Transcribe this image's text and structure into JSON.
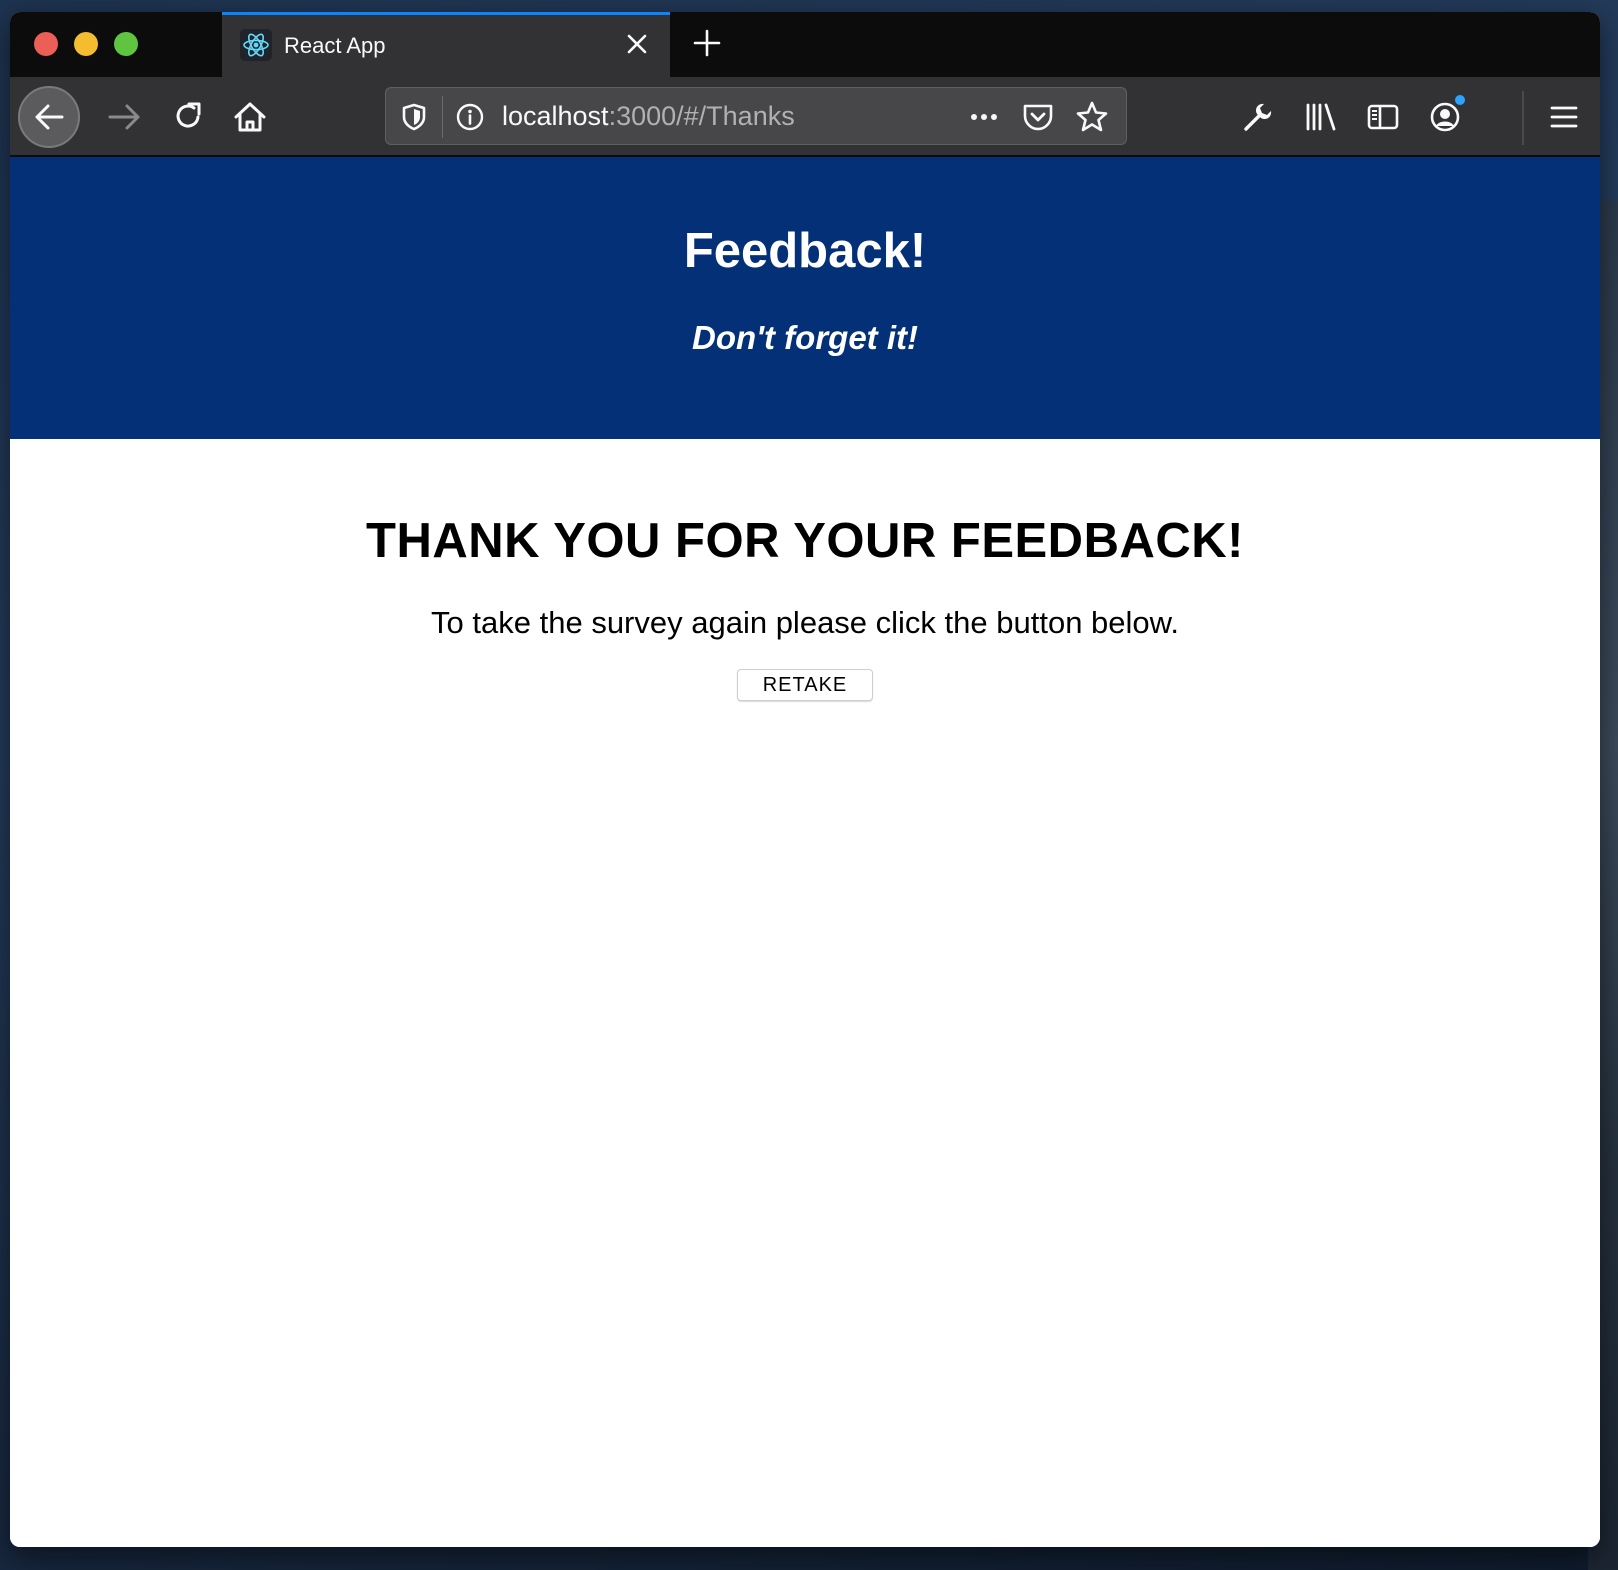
{
  "browser": {
    "tab": {
      "title": "React App",
      "favicon": "react-logo-icon"
    },
    "url": {
      "host": "localhost",
      "rest": ":3000/#/Thanks"
    },
    "accent_color": "#0a84ff"
  },
  "page": {
    "header": {
      "title": "Feedback!",
      "subtitle": "Don't forget it!",
      "background_color": "#043078"
    },
    "main": {
      "heading": "THANK YOU FOR YOUR FEEDBACK!",
      "message": "To take the survey again please click the button below.",
      "retake_label": "RETAKE"
    }
  }
}
